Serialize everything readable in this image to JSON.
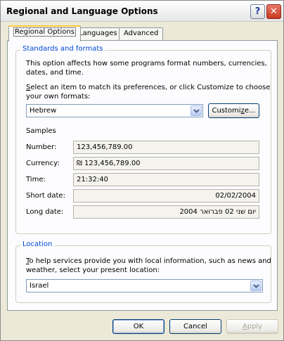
{
  "window": {
    "title": "Regional and Language Options"
  },
  "titlebar": {
    "help_glyph": "?",
    "close_glyph": "✕"
  },
  "tabs": [
    {
      "label": "Regional Options",
      "active": true
    },
    {
      "label": "Languages",
      "active": false
    },
    {
      "label": "Advanced",
      "active": false
    }
  ],
  "standards": {
    "legend": "Standards and formats",
    "description_line1": "This option affects how some programs format numbers, currencies,",
    "description_line2": "dates, and time.",
    "select_line1_key": "S",
    "select_line1_rest": "elect an item to match its preferences, or click Customize to choose",
    "select_line2": "your own formats:",
    "format_value": "Hebrew",
    "customize_button_key": "z",
    "customize_button_pre": "Customi",
    "customize_button_post": "e...",
    "samples_label": "Samples",
    "samples": {
      "number_label": "Number:",
      "number_value": "123,456,789.00",
      "currency_label": "Currency:",
      "currency_value": "₪ 123,456,789.00",
      "time_label": "Time:",
      "time_value": "21:32:40",
      "short_date_label": "Short date:",
      "short_date_value": "02/02/2004",
      "long_date_label": "Long date:",
      "long_date_value": "יום שני 02 פברואר 2004"
    }
  },
  "location": {
    "legend": "Location",
    "description_line1_key": "T",
    "description_line1_rest": "o help services provide you with local information, such as news and",
    "description_line2": "weather, select your present location:",
    "value": "Israel"
  },
  "buttons": {
    "ok": "OK",
    "cancel": "Cancel",
    "apply_key": "A",
    "apply_rest": "pply"
  },
  "icons": {
    "dropdown_arrow": "chevron-down-icon",
    "help": "help-icon",
    "close": "close-icon"
  },
  "colors": {
    "window_bg": "#ece9d8",
    "panel_bg": "#fcfcfe",
    "group_legend": "#0046d5",
    "active_tab_accent": "#ffc83c",
    "close_button": "#c8381f"
  }
}
